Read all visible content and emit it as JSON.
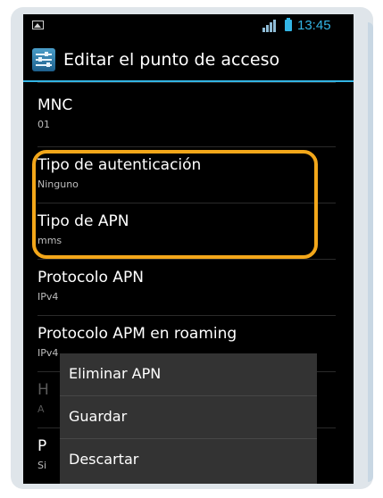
{
  "status_bar": {
    "time": "13:45",
    "icons": [
      "image-notification-icon",
      "signal-icon",
      "battery-icon"
    ],
    "accent_color": "#33b5e5"
  },
  "action_bar": {
    "title": "Editar el punto de acceso",
    "icon": "settings-icon"
  },
  "settings_list": [
    {
      "title": "MNC",
      "value": "01"
    },
    {
      "title": "Tipo de autenticación",
      "value": "Ninguno"
    },
    {
      "title": "Tipo de APN",
      "value": "mms"
    },
    {
      "title": "Protocolo APN",
      "value": "IPv4"
    },
    {
      "title": "Protocolo APM en roaming",
      "value": "IPv4"
    },
    {
      "title": "H",
      "value": "A"
    },
    {
      "title": "P",
      "value": "Si"
    }
  ],
  "highlight_color": "#f3a71a",
  "options_menu": [
    {
      "label": "Eliminar APN"
    },
    {
      "label": "Guardar"
    },
    {
      "label": "Descartar"
    }
  ]
}
